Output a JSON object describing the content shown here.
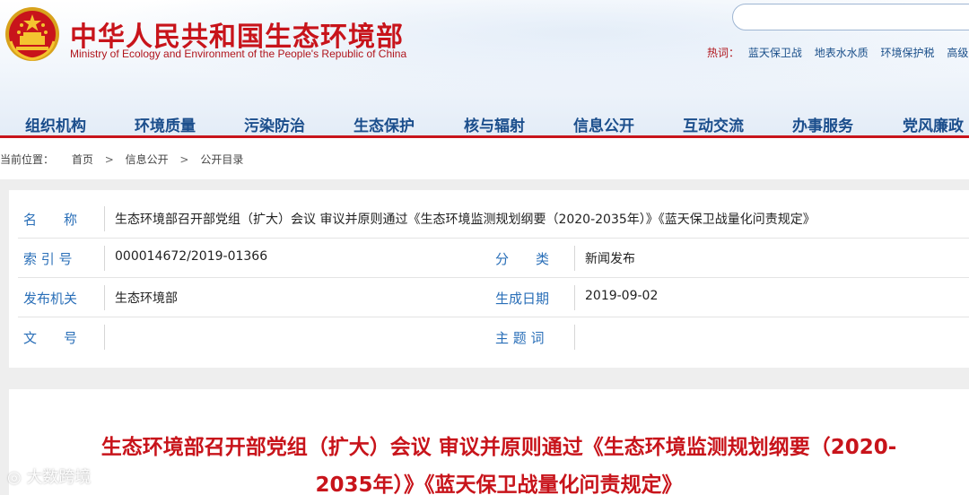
{
  "header": {
    "title": "中华人民共和国生态环境部",
    "subtitle": "Ministry of Ecology and Environment of the People's Republic of China",
    "search_placeholder": "",
    "hot_label": "热词：",
    "hot_links": [
      "蓝天保卫战",
      "地表水水质",
      "环境保护税",
      "高级"
    ]
  },
  "nav": {
    "items": [
      "组织机构",
      "环境质量",
      "污染防治",
      "生态保护",
      "核与辐射",
      "信息公开",
      "互动交流",
      "办事服务",
      "党风廉政"
    ]
  },
  "breadcrumb": {
    "prefix": "当前位置：",
    "items": [
      "首页",
      "信息公开",
      "公开目录"
    ],
    "sep": ">"
  },
  "info": {
    "name_label": "名　　称",
    "name_value": "生态环境部召开部党组（扩大）会议 审议并原则通过《生态环境监测规划纲要（2020-2035年）》《蓝天保卫战量化问责规定》",
    "index_label": "索 引 号",
    "index_value": "000014672/2019-01366",
    "category_label": "分　　类",
    "category_value": "新闻发布",
    "issuer_label": "发布机关",
    "issuer_value": "生态环境部",
    "date_label": "生成日期",
    "date_value": "2019-09-02",
    "doc_no_label": "文　　号",
    "doc_no_value": "",
    "subject_label": "主 题 词",
    "subject_value": ""
  },
  "article": {
    "title_line1": "生态环境部召开部党组（扩大）会议 审议并原则通过《生态环境监测规划纲要（2020-",
    "title_line2": "2035年）》《蓝天保卫战量化问责规定》"
  },
  "watermark": "大数跨境",
  "colors": {
    "brand_red": "#c8141b",
    "nav_blue": "#1b4e8c",
    "label_blue": "#2a6fb8"
  }
}
